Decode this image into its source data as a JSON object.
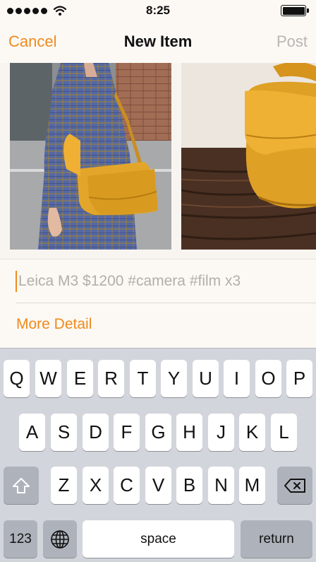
{
  "status_bar": {
    "time": "8:25",
    "signal_dots": 5,
    "battery_level": 1.0
  },
  "nav": {
    "cancel_label": "Cancel",
    "title": "New Item",
    "post_label": "Post"
  },
  "composer": {
    "placeholder": "Leica M3 $1200 #camera #film x3",
    "value": ""
  },
  "more_detail_label": "More Detail",
  "keyboard": {
    "row1": [
      "Q",
      "W",
      "E",
      "R",
      "T",
      "Y",
      "U",
      "I",
      "O",
      "P"
    ],
    "row2": [
      "A",
      "S",
      "D",
      "F",
      "G",
      "H",
      "J",
      "K",
      "L"
    ],
    "row3": [
      "Z",
      "X",
      "C",
      "V",
      "B",
      "N",
      "M"
    ],
    "numbers_label": "123",
    "space_label": "space",
    "return_label": "return"
  },
  "colors": {
    "accent": "#f08a1c",
    "disabled": "#b8b5b2",
    "keyboard_bg": "#d2d5db"
  },
  "icons": [
    "wifi-icon",
    "battery-icon",
    "shift-icon",
    "delete-icon",
    "globe-icon"
  ]
}
